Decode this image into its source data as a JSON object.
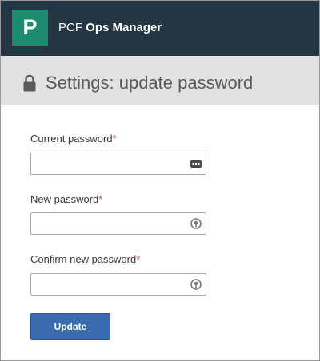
{
  "header": {
    "logo_letter": "P",
    "app_name_prefix": "PCF",
    "app_name_strong": "Ops Manager",
    "background_color": "#243641",
    "logo_color": "#1b8c6f"
  },
  "page": {
    "title": "Settings: update password",
    "title_icon": "lock-icon"
  },
  "form": {
    "required_marker": "*",
    "fields": [
      {
        "label": "Current password",
        "value": "",
        "icon": "password-manager-icon"
      },
      {
        "label": "New password",
        "value": "",
        "icon": "password-key-icon"
      },
      {
        "label": "Confirm new password",
        "value": "",
        "icon": "password-key-icon"
      }
    ],
    "submit_label": "Update",
    "submit_color": "#3a6ab0",
    "required_color": "#d0453a"
  }
}
